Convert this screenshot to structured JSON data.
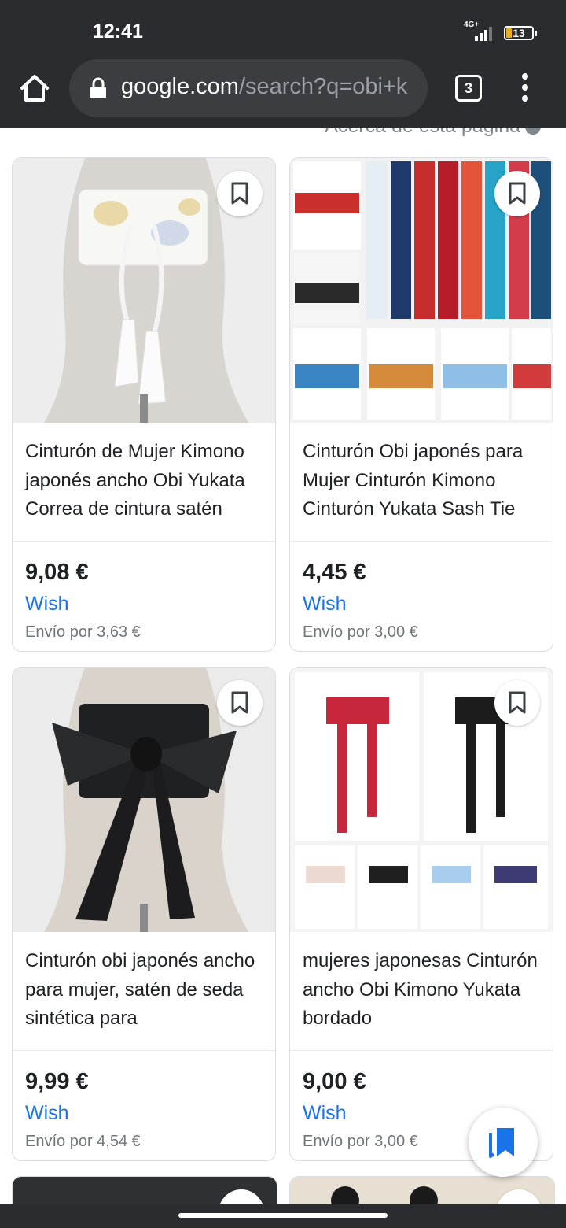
{
  "status_bar": {
    "time": "12:41",
    "network": "4G+",
    "battery": "13"
  },
  "toolbar": {
    "url_domain": "google.com",
    "url_path": "/search?q=obi+k",
    "tab_count": "3"
  },
  "page": {
    "about_label": "Acerca de esta página"
  },
  "products": [
    {
      "title": "Cinturón de Mujer Kimono japonés ancho Obi Yukata Correa de cintura satén",
      "price": "9,08 €",
      "seller": "Wish",
      "shipping": "Envío por 3,63 €"
    },
    {
      "title": "Cinturón Obi japonés para Mujer Cinturón Kimono Cinturón Yukata Sash Tie",
      "price": "4,45 €",
      "seller": "Wish",
      "shipping": "Envío por 3,00 €"
    },
    {
      "title": "Cinturón obi japonés ancho para mujer, satén de seda sintética para",
      "price": "9,99 €",
      "seller": "Wish",
      "shipping": "Envío por 4,54 €"
    },
    {
      "title": "mujeres japonesas Cinturón ancho Obi Kimono Yukata bordado",
      "price": "9,00 €",
      "seller": "Wish",
      "shipping": "Envío por 3,00 €"
    }
  ],
  "colors": {
    "link": "#1a73e8",
    "chrome": "#2b2c30",
    "omnibox": "#3c3d41",
    "fab_icon": "#1a73e8"
  },
  "icons": [
    "home-icon",
    "lock-icon",
    "tab-switcher-icon",
    "overflow-menu-icon",
    "bookmark-icon",
    "saved-collection-icon",
    "info-icon"
  ]
}
